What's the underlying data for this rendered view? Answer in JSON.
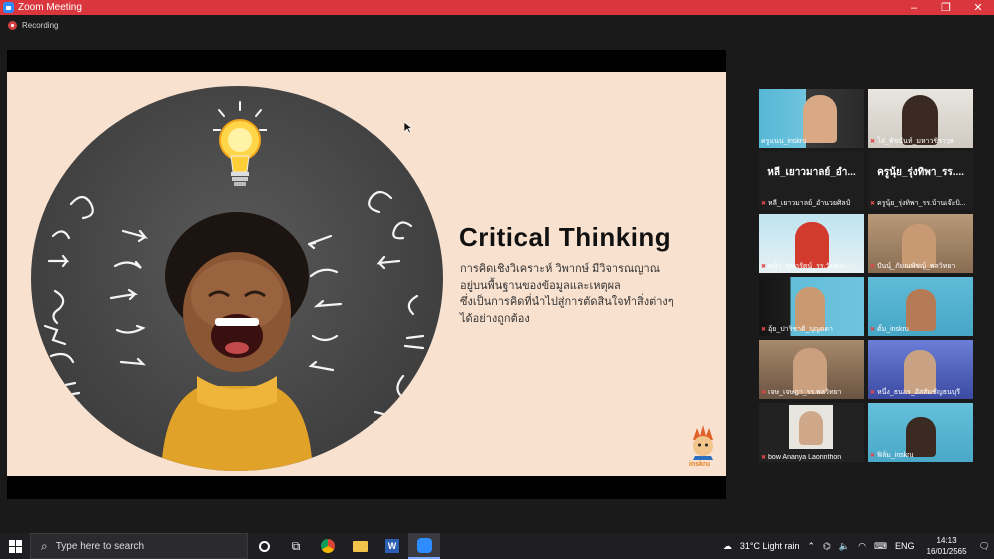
{
  "window": {
    "title": "Zoom Meeting",
    "minimize": "–",
    "maximize": "❐",
    "close": "✕"
  },
  "recording": {
    "label": "Recording"
  },
  "slide": {
    "title": "Critical Thinking",
    "lines": [
      "การคิดเชิงวิเคราะห์ วิพากษ์ มีวิจารณญาณ",
      "อยู่บนพื้นฐานของข้อมูลและเหตุผล",
      "ซึ่งเป็นการคิดที่นำไปสู่การตัดสินใจทำสิ่งต่างๆ",
      "ได้อย่างถูกต้อง"
    ],
    "brand": "inskru"
  },
  "participants": [
    {
      "name": "ครูแนน_inskru",
      "muted": false
    },
    {
      "name": "โอ๋_พัชนันท์_มหาวชิราวุธ",
      "muted": true
    },
    {
      "name": "หลี_เยาวมาลย์_อำนวยศิลป์",
      "display": "หลี_เยาวมาลย์_อำ...",
      "muted": true
    },
    {
      "name": "ครูนุ้ย_รุ่งทิพา_รร.บ้านเจ๊ะบิ...",
      "display": "ครูนุ้ย_รุ่งทิพา_รร....",
      "muted": true
    },
    {
      "name": "หน้า_จุฑารัตน์_รร.วัดพระ...",
      "muted": true
    },
    {
      "name": "ปันนุ์_ภัมณพัชญ์_พลวิทยา",
      "muted": true
    },
    {
      "name": "อุ้ย_ปาริชาติ_บุญดดา",
      "muted": true
    },
    {
      "name": "ตั้ม_inskru",
      "muted": true
    },
    {
      "name": "เจษ_เจษฎา_รร.พลวิทยา",
      "muted": true
    },
    {
      "name": "หนึ่ง_ธนอร_อัสสัมชัญธนบุรี",
      "muted": true
    },
    {
      "name": "bow Ananya Laorinthon",
      "muted": true
    },
    {
      "name": "ฟิล์ม_inskru",
      "muted": true
    }
  ],
  "taskbar": {
    "search_placeholder": "Type here to search",
    "weather": "31°C  Light rain",
    "lang": "ENG",
    "time": "14:13",
    "date": "16/01/2565"
  },
  "colors": {
    "titlebar": "#d9363e",
    "active_speaker": "#e6d84a",
    "slide_bg": "#f9e1cf"
  }
}
